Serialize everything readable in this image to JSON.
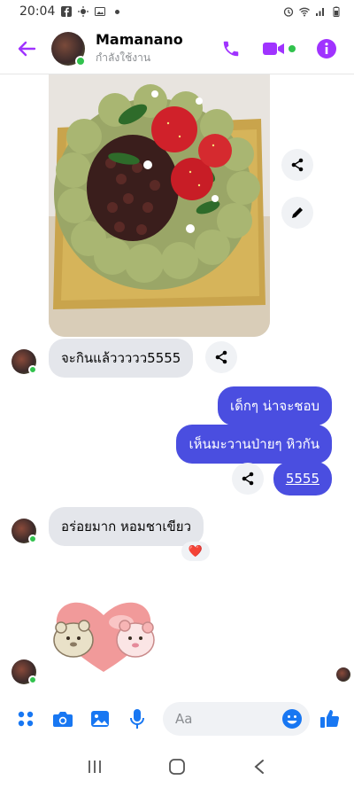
{
  "status_bar": {
    "time": "20:04"
  },
  "header": {
    "name": "Mamanano",
    "status": "กำลังใช้งาน"
  },
  "messages": [
    {
      "from": "them",
      "type": "image",
      "description": "cake"
    },
    {
      "from": "them",
      "text": "จะกินแล้ววววว5555"
    },
    {
      "from": "me",
      "text": "เด็กๆ น่าจะชอบ"
    },
    {
      "from": "me",
      "text": "เห็นมะวานป่ายๆ หิวกัน"
    },
    {
      "from": "me",
      "text": "5555"
    },
    {
      "from": "them",
      "text": "อร่อยมาก หอมชาเขียว",
      "reaction": "❤️"
    },
    {
      "from": "them",
      "type": "sticker",
      "description": "heart-hug-sticker"
    }
  ],
  "composer": {
    "placeholder": "Aa"
  },
  "colors": {
    "accent": "#a033ff",
    "bubble_out": "#4a4ee0",
    "online": "#31c24d",
    "bubble_in": "#e4e6eb"
  }
}
